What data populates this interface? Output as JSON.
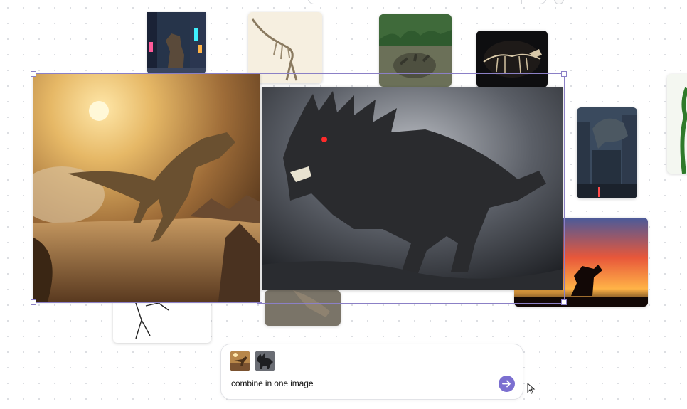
{
  "composer": {
    "prompt_text": "combine in one image"
  },
  "accent_color": "#7b6fd0",
  "selection_color": "#8b80c6",
  "icons": {
    "send": "arrow-right-icon",
    "pointer": "mouse-pointer-icon"
  }
}
